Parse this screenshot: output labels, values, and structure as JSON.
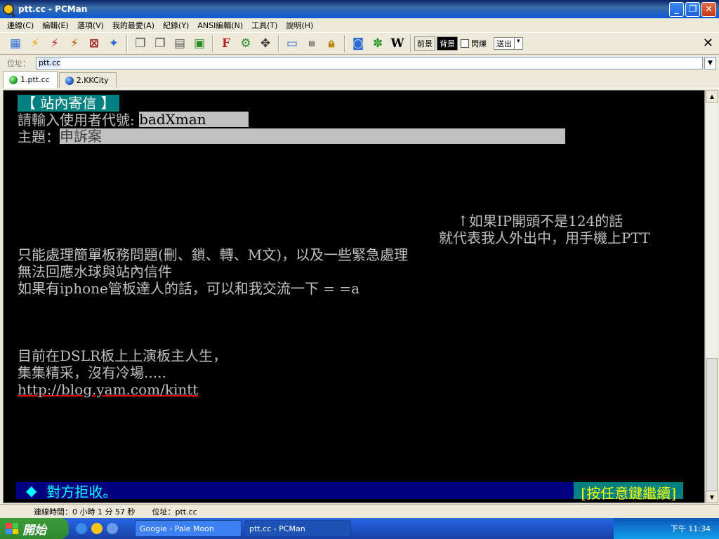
{
  "window": {
    "title": "ptt.cc - PCMan"
  },
  "menu": [
    "連線(C)",
    "編輯(E)",
    "選項(V)",
    "我的最愛(A)",
    "紀錄(Y)",
    "ANSI編輯(N)",
    "工具(T)",
    "說明(H)"
  ],
  "toolbar": {
    "fg_label": "前景",
    "bg_label": "背景",
    "blink_label": "閃爍",
    "send_label": "送出"
  },
  "address": {
    "label": "位址：",
    "value": "ptt.cc"
  },
  "tabs": [
    {
      "label": "1.ptt.cc",
      "icon": "green-globe-icon",
      "color": "#2a9a2a"
    },
    {
      "label": "2.KKCity",
      "icon": "blue-globe-icon",
      "color": "#2258c8"
    }
  ],
  "terminal": {
    "header": "【 站內寄信 】",
    "user_prompt": "請輸入使用者代號: ",
    "user_value": "badXman",
    "subject_prompt": "主題：",
    "subject_value": "申訴案",
    "note1": "↑如果IP開頭不是124的話",
    "note2": "就代表我人外出中，用手機上PTT",
    "line1": "只能處理簡單板務問題(刪、鎖、轉、M文)，以及一些緊急處理",
    "line2": "無法回應水球與站內信件",
    "line3": "如果有iphone管板達人的話，可以和我交流一下 = =a",
    "line4": "目前在DSLR板上上演板主人生，",
    "line5": "集集精采，沒有冷場.....",
    "url": "http://blog.yam.com/kintt",
    "status_diamond": "◆",
    "status_msg": "對方拒收。",
    "status_continue": "[按任意鍵繼續]"
  },
  "statusbar": {
    "time": "連線時間：0 小時 1 分 57 秒",
    "addr": "位址：ptt.cc"
  },
  "taskbar": {
    "start": "開始",
    "tasks": [
      "Google - Pale Moon",
      "ptt.cc - PCMan"
    ],
    "clock": "下午 11:34"
  }
}
